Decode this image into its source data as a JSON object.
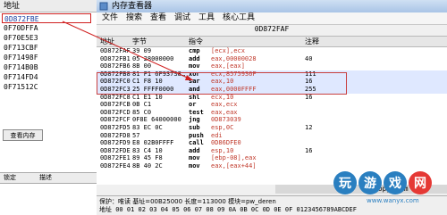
{
  "left_panel": {
    "title": "地址",
    "addresses": [
      "0D872FBE",
      "0F70DFFA",
      "0F70E5E3",
      "0F713CBF",
      "0F71498F",
      "0F714B0B",
      "0F714FD4",
      "0F71512C"
    ],
    "selected_index": 0,
    "view_memory_button": "查看内存",
    "columns": [
      "锁定",
      "描述"
    ]
  },
  "window": {
    "title": "内存查看器",
    "menu": [
      "文件",
      "搜索",
      "查看",
      "调试",
      "工具",
      "核心工具"
    ],
    "current_address": "0D872FAF",
    "headers": {
      "address": "地址",
      "bytes": "字节",
      "opcode": "指令",
      "comment": "注释"
    },
    "rows": [
      {
        "addr": "0D872FAF",
        "bytes": "39 09",
        "op": "cmp",
        "arg": "[ecx],ecx",
        "cmt": "",
        "hl": false
      },
      {
        "addr": "0D872FB1",
        "bytes": "05 28000000",
        "op": "add",
        "arg": "eax,00000028",
        "cmt": "40",
        "hl": false
      },
      {
        "addr": "0D872FB6",
        "bytes": "8B 00",
        "op": "mov",
        "arg": "eax,[eax]",
        "cmt": "",
        "hl": false
      },
      {
        "addr": "0D872FB8",
        "bytes": "81 F1 6F937S8…",
        "op": "xor",
        "arg": "ecx,8575936F",
        "cmt": "111",
        "hl": true
      },
      {
        "addr": "0D872FC0",
        "bytes": "C1 F8 10",
        "op": "sar",
        "arg": "eax,10",
        "cmt": "16",
        "hl": true
      },
      {
        "addr": "0D872FC3",
        "bytes": "25 FFFF0000",
        "op": "and",
        "arg": "eax,0000FFFF",
        "cmt": "255",
        "hl": true
      },
      {
        "addr": "0D872FC8",
        "bytes": "C1 E1 10",
        "op": "shl",
        "arg": "ecx,10",
        "cmt": "16",
        "hl": false
      },
      {
        "addr": "0D872FCB",
        "bytes": "0B C1",
        "op": "or",
        "arg": "eax,ecx",
        "cmt": "",
        "hl": false
      },
      {
        "addr": "0D872FCD",
        "bytes": "85 C0",
        "op": "test",
        "arg": "eax,eax",
        "cmt": "",
        "hl": false
      },
      {
        "addr": "0D872FCF",
        "bytes": "0F8E 64000000",
        "op": "jng",
        "arg": "0D873039",
        "cmt": "",
        "hl": false
      },
      {
        "addr": "0D872FD5",
        "bytes": "83 EC 0C",
        "op": "sub",
        "arg": "esp,0C",
        "cmt": "12",
        "hl": false
      },
      {
        "addr": "0D872FD8",
        "bytes": "57",
        "op": "push",
        "arg": "edi",
        "cmt": "",
        "hl": false
      },
      {
        "addr": "0D872FD9",
        "bytes": "E8 02B0FFFF",
        "op": "call",
        "arg": "0D86DFE0",
        "cmt": "",
        "hl": false
      },
      {
        "addr": "0D872FDE",
        "bytes": "83 C4 10",
        "op": "add",
        "arg": "esp,10",
        "cmt": "16",
        "hl": false
      },
      {
        "addr": "0D872FE1",
        "bytes": "89 45 F8",
        "op": "mov",
        "arg": "[ebp-08],eax",
        "cmt": "",
        "hl": false
      },
      {
        "addr": "0D872FE4",
        "bytes": "8B 40 2C",
        "op": "mov",
        "arg": "eax,[eax+44]",
        "cmt": "",
        "hl": false
      }
    ],
    "copy_text": "copy mem",
    "status_line1": "保护：唯读    基址=00B25000  长度=113000  模块=pw_deren",
    "status_line2": "地址       00 01 02 03 04 05 06 07 08 09 0A 0B 0C 0D 0E 0F 0123456789ABCDEF"
  },
  "watermark": {
    "text": "玩游戏网",
    "url": "www.wanyx.com",
    "color": "#2a7fc0"
  }
}
